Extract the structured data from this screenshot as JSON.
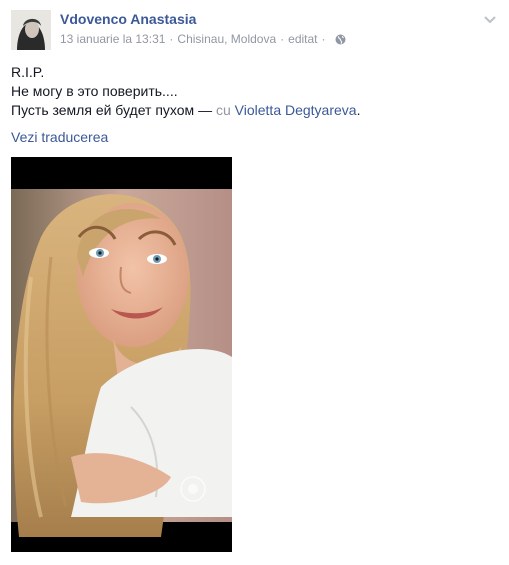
{
  "post": {
    "author": "Vdovenco Anastasia",
    "date": "13 ianuarie la 13:31",
    "separator": "·",
    "location": "Chisinau, Moldova",
    "edited": "editat",
    "privacy_icon": "globe-icon",
    "menu_icon": "chevron-down-icon",
    "text_line1": "R.I.P.",
    "text_line2": "Не могу в это поверить....",
    "text_line3": "Пусть земля ей будет пухом",
    "tag_dash": "—",
    "tag_prefix": "cu",
    "tagged_person": "Violetta Degtyareva",
    "tag_suffix": ".",
    "translate_link": "Vezi traducerea",
    "photo": "portrait-photo"
  },
  "colors": {
    "link": "#3b5998",
    "meta": "#9197a3",
    "text": "#141823"
  }
}
